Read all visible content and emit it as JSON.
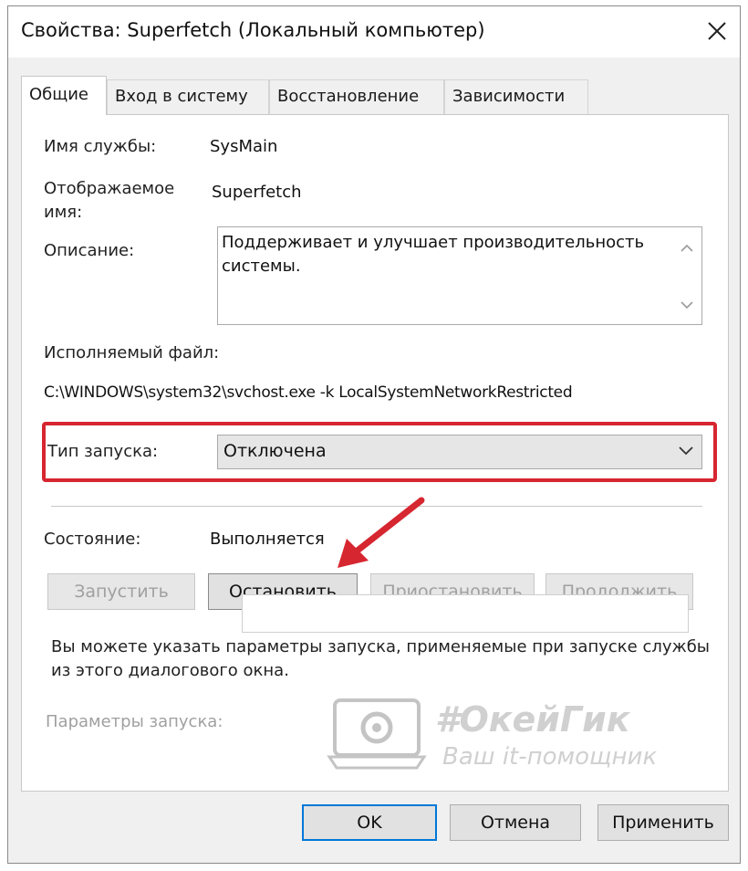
{
  "window": {
    "title": "Свойства: Superfetch (Локальный компьютер)",
    "close_icon": "close-icon"
  },
  "tabs": [
    {
      "label": "Общие",
      "active": true
    },
    {
      "label": "Вход в систему",
      "active": false
    },
    {
      "label": "Восстановление",
      "active": false
    },
    {
      "label": "Зависимости",
      "active": false
    }
  ],
  "general": {
    "service_name_label": "Имя службы:",
    "service_name": "SysMain",
    "display_name_label_line1": "Отображаемое",
    "display_name_label_line2": "имя:",
    "display_name": "Superfetch",
    "description_label": "Описание:",
    "description": "Поддерживает и улучшает производительность системы.",
    "executable_label": "Исполняемый файл:",
    "executable_path": "C:\\WINDOWS\\system32\\svchost.exe -k LocalSystemNetworkRestricted",
    "startup_type_label": "Тип запуска:",
    "startup_type_value": "Отключена",
    "status_label": "Состояние:",
    "status_value": "Выполняется",
    "buttons": {
      "start": "Запустить",
      "stop": "Остановить",
      "pause": "Приостановить",
      "resume": "Продолжить"
    },
    "hint": "Вы можете указать параметры запуска, применяемые при запуске службы из этого диалогового окна.",
    "start_params_label": "Параметры запуска:",
    "start_params_value": ""
  },
  "watermark": {
    "brand": "#ОкейГик",
    "slogan": "Ваш it-помощник"
  },
  "footer": {
    "ok": "OK",
    "cancel": "Отмена",
    "apply": "Применить"
  },
  "colors": {
    "highlight": "#d62630",
    "arrow": "#d62630",
    "focus": "#0078d7"
  }
}
